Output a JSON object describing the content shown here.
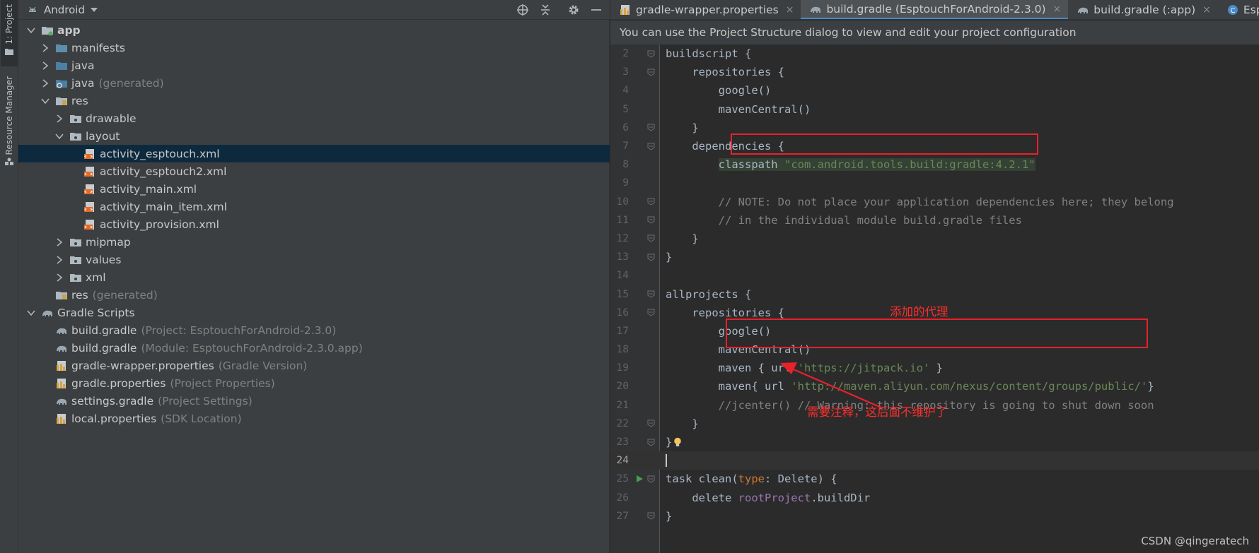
{
  "left_stripe": {
    "project_tab": "1: Project",
    "resource_tab": "Resource Manager"
  },
  "project_panel": {
    "view_mode": "Android",
    "tree": [
      {
        "label": "app",
        "icon": "module-folder-icon",
        "depth": 0,
        "arrow": "down",
        "bold": true
      },
      {
        "label": "manifests",
        "icon": "folder-icon",
        "depth": 1,
        "arrow": "right"
      },
      {
        "label": "java",
        "icon": "source-folder-icon",
        "depth": 1,
        "arrow": "right"
      },
      {
        "label": "java",
        "suffix": "(generated)",
        "icon": "generated-folder-icon",
        "depth": 1,
        "arrow": "right"
      },
      {
        "label": "res",
        "icon": "res-folder-icon",
        "depth": 1,
        "arrow": "down"
      },
      {
        "label": "drawable",
        "icon": "package-folder-icon",
        "depth": 2,
        "arrow": "right"
      },
      {
        "label": "layout",
        "icon": "package-folder-icon",
        "depth": 2,
        "arrow": "down"
      },
      {
        "label": "activity_esptouch.xml",
        "icon": "layout-xml-icon",
        "depth": 3,
        "selected": true
      },
      {
        "label": "activity_esptouch2.xml",
        "icon": "layout-xml-icon",
        "depth": 3
      },
      {
        "label": "activity_main.xml",
        "icon": "layout-xml-icon",
        "depth": 3
      },
      {
        "label": "activity_main_item.xml",
        "icon": "layout-xml-icon",
        "depth": 3
      },
      {
        "label": "activity_provision.xml",
        "icon": "layout-xml-icon",
        "depth": 3
      },
      {
        "label": "mipmap",
        "icon": "package-folder-icon",
        "depth": 2,
        "arrow": "right"
      },
      {
        "label": "values",
        "icon": "package-folder-icon",
        "depth": 2,
        "arrow": "right"
      },
      {
        "label": "xml",
        "icon": "package-folder-icon",
        "depth": 2,
        "arrow": "right"
      },
      {
        "label": "res",
        "suffix": "(generated)",
        "icon": "res-folder-icon",
        "depth": 1
      },
      {
        "label": "Gradle Scripts",
        "icon": "gradle-elephant-icon",
        "depth": 0,
        "arrow": "down"
      },
      {
        "label": "build.gradle",
        "suffix": "(Project: EsptouchForAndroid-2.3.0)",
        "icon": "gradle-file-icon",
        "depth": 1
      },
      {
        "label": "build.gradle",
        "suffix": "(Module: EsptouchForAndroid-2.3.0.app)",
        "icon": "gradle-file-icon",
        "depth": 1
      },
      {
        "label": "gradle-wrapper.properties",
        "suffix": "(Gradle Version)",
        "icon": "properties-file-icon",
        "depth": 1
      },
      {
        "label": "gradle.properties",
        "suffix": "(Project Properties)",
        "icon": "properties-file-icon",
        "depth": 1
      },
      {
        "label": "settings.gradle",
        "suffix": "(Project Settings)",
        "icon": "gradle-file-icon",
        "depth": 1
      },
      {
        "label": "local.properties",
        "suffix": "(SDK Location)",
        "icon": "properties-file-icon",
        "depth": 1
      }
    ]
  },
  "editor_tabs": [
    {
      "label": "gradle-wrapper.properties",
      "icon": "properties-file-icon",
      "close": "×"
    },
    {
      "label": "build.gradle (EsptouchForAndroid-2.3.0)",
      "icon": "gradle-file-icon",
      "close": "×",
      "active": true
    },
    {
      "label": "build.gradle (:app)",
      "icon": "gradle-file-icon",
      "close": "×"
    },
    {
      "label": "EspTouch",
      "icon": "class-file-icon"
    }
  ],
  "banner": "You can use the Project Structure dialog to view and edit your project configuration",
  "code_lines": [
    {
      "n": "2",
      "fold": true,
      "parts": [
        [
          "",
          "buildscript {"
        ]
      ]
    },
    {
      "n": "3",
      "fold": true,
      "parts": [
        [
          "",
          "    repositories {"
        ]
      ]
    },
    {
      "n": "4",
      "parts": [
        [
          "",
          "        google()"
        ]
      ]
    },
    {
      "n": "5",
      "parts": [
        [
          "",
          "        mavenCentral()"
        ]
      ]
    },
    {
      "n": "6",
      "fold": true,
      "parts": [
        [
          "",
          "    }"
        ]
      ]
    },
    {
      "n": "7",
      "fold": true,
      "parts": [
        [
          "",
          "    dependencies {"
        ]
      ]
    },
    {
      "n": "8",
      "parts": [
        [
          "",
          "        "
        ],
        [
          "hl",
          "classpath "
        ],
        [
          "str hl",
          "\"com.android.tools.build:gradle:4.2.1\""
        ]
      ]
    },
    {
      "n": "9",
      "parts": [
        [
          "",
          ""
        ]
      ]
    },
    {
      "n": "10",
      "fold": true,
      "parts": [
        [
          "cmt",
          "        // NOTE: Do not place your application dependencies here; they belong"
        ]
      ]
    },
    {
      "n": "11",
      "fold": true,
      "parts": [
        [
          "cmt",
          "        // in the individual module build.gradle files"
        ]
      ]
    },
    {
      "n": "12",
      "fold": true,
      "parts": [
        [
          "",
          "    }"
        ]
      ]
    },
    {
      "n": "13",
      "fold": true,
      "parts": [
        [
          "",
          "}"
        ]
      ]
    },
    {
      "n": "14",
      "parts": [
        [
          "",
          ""
        ]
      ]
    },
    {
      "n": "15",
      "fold": true,
      "parts": [
        [
          "",
          "allprojects {"
        ]
      ]
    },
    {
      "n": "16",
      "fold": true,
      "parts": [
        [
          "",
          "    repositories {"
        ]
      ]
    },
    {
      "n": "17",
      "parts": [
        [
          "",
          "        google()"
        ]
      ]
    },
    {
      "n": "18",
      "parts": [
        [
          "",
          "        mavenCentral()"
        ]
      ]
    },
    {
      "n": "19",
      "parts": [
        [
          "",
          "        maven { url "
        ],
        [
          "str",
          "'https://jitpack.io'"
        ],
        [
          "",
          " }"
        ]
      ]
    },
    {
      "n": "20",
      "parts": [
        [
          "",
          "        maven{ url "
        ],
        [
          "str",
          "'http://maven.aliyun.com/nexus/content/groups/public/'"
        ],
        [
          "",
          "}"
        ]
      ]
    },
    {
      "n": "21",
      "parts": [
        [
          "cmt",
          "        //jcenter() // Warning: this repository is going to shut down soon"
        ]
      ]
    },
    {
      "n": "22",
      "fold": true,
      "parts": [
        [
          "",
          "    }"
        ]
      ]
    },
    {
      "n": "23",
      "fold": true,
      "bulb": true,
      "parts": [
        [
          "",
          "}"
        ]
      ]
    },
    {
      "n": "24",
      "current": true,
      "parts": [
        [
          "",
          ""
        ]
      ]
    },
    {
      "n": "25",
      "fold": true,
      "run": true,
      "parts": [
        [
          "",
          "task clean("
        ],
        [
          "kw",
          "type"
        ],
        [
          "",
          ": Delete) {"
        ]
      ]
    },
    {
      "n": "26",
      "parts": [
        [
          "",
          "    delete "
        ],
        [
          "prm",
          "rootProject"
        ],
        [
          "",
          ".buildDir"
        ]
      ]
    },
    {
      "n": "27",
      "fold": true,
      "parts": [
        [
          "",
          "}"
        ]
      ]
    }
  ],
  "annotations": {
    "proxy_label": "添加的代理",
    "comment_label": "需要注释，这后面不维护了",
    "color": "#e8212b"
  },
  "watermark": "CSDN @qingeratech",
  "colors": {
    "editor_bg": "#2b2b2b",
    "panel_bg": "#3c3f41",
    "selection": "#0d293e",
    "string": "#6a8759",
    "comment": "#808080",
    "keyword": "#cc7832"
  }
}
